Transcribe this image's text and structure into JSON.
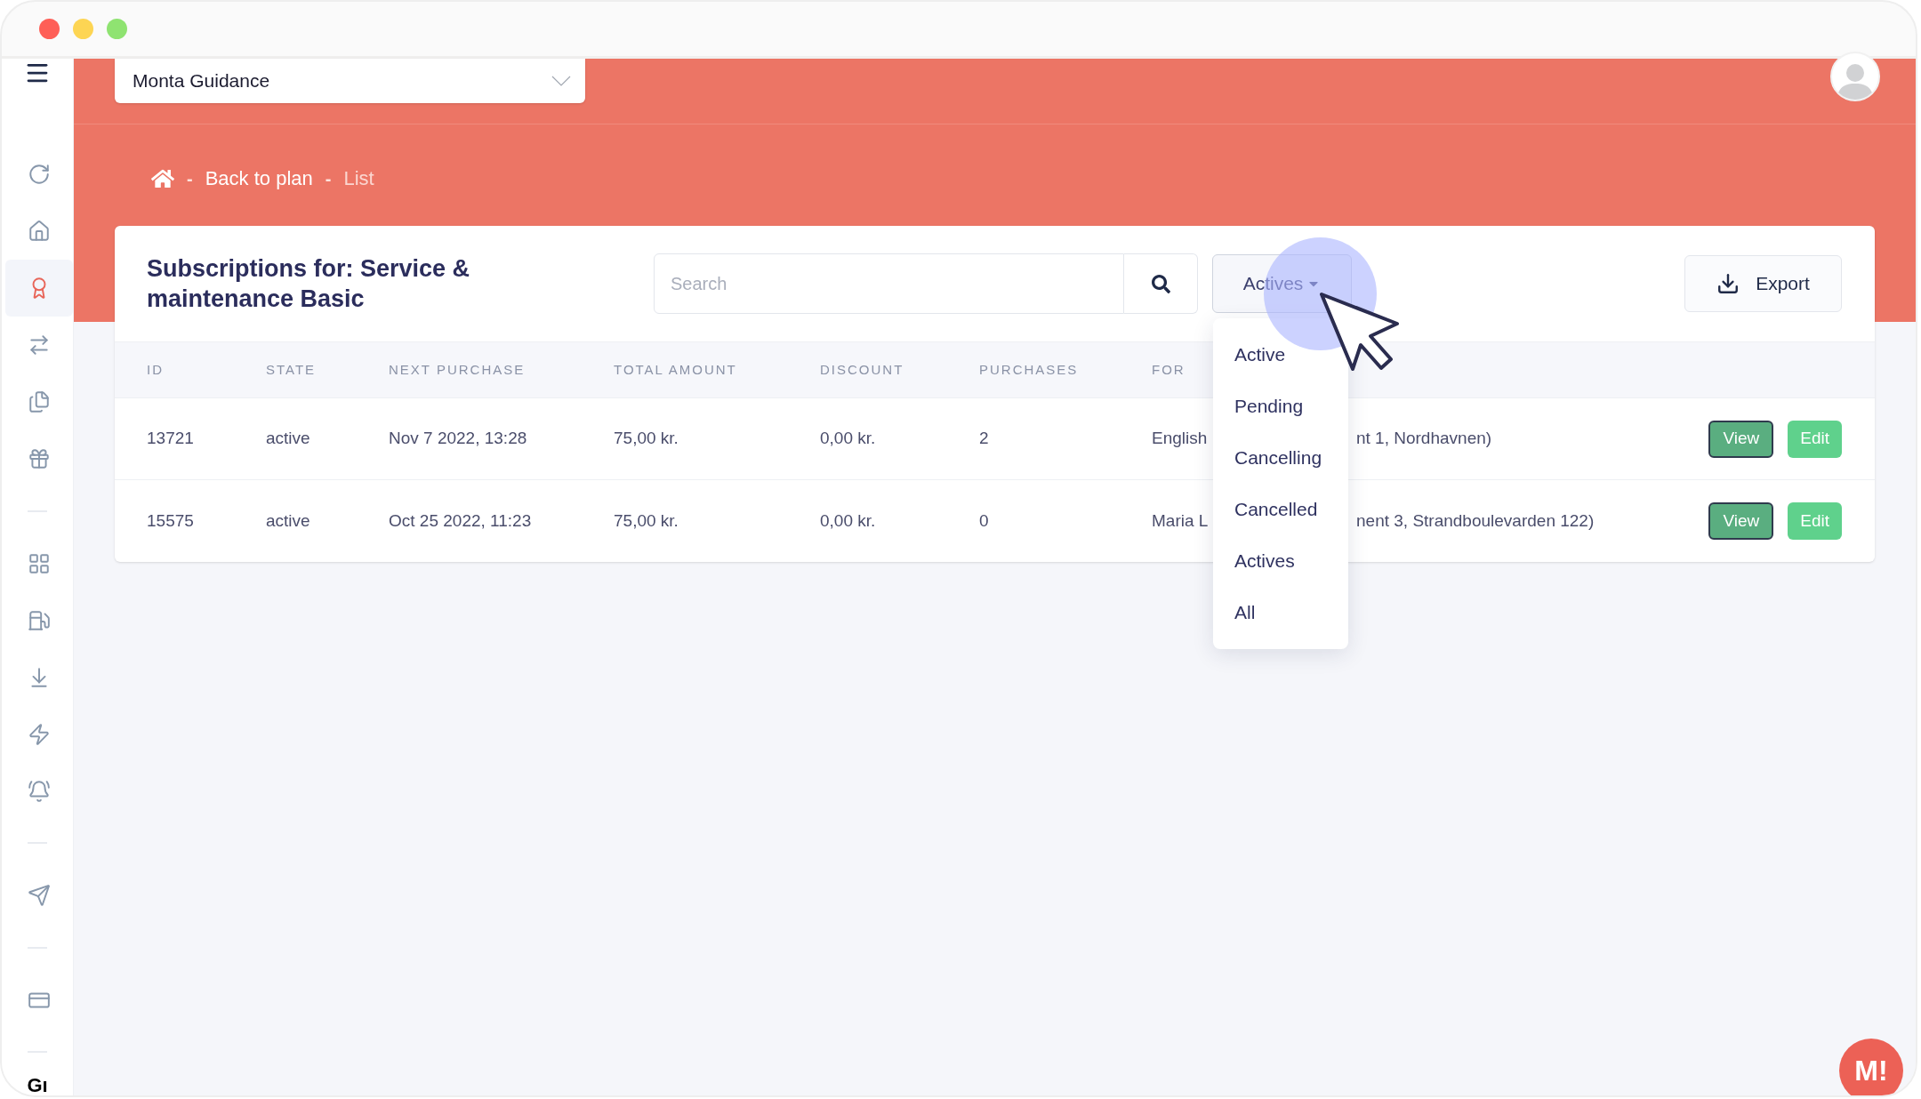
{
  "top_bar": {
    "workspace_select": {
      "value": "Monta Guidance"
    }
  },
  "sidebar": {
    "groups": [
      {
        "items": [
          {
            "kind": "refresh",
            "selected": false
          },
          {
            "kind": "home",
            "selected": false
          },
          {
            "kind": "award",
            "selected": true
          },
          {
            "kind": "transfer",
            "selected": false
          },
          {
            "kind": "documents",
            "selected": false
          },
          {
            "kind": "gift",
            "selected": false
          }
        ]
      },
      {
        "items": [
          {
            "kind": "grid",
            "selected": false
          },
          {
            "kind": "fuel",
            "selected": false
          },
          {
            "kind": "download",
            "selected": false
          },
          {
            "kind": "bolt",
            "selected": false
          },
          {
            "kind": "bell",
            "selected": false
          }
        ]
      },
      {
        "items": [
          {
            "kind": "send",
            "selected": false
          }
        ]
      },
      {
        "items": [
          {
            "kind": "cards",
            "selected": false
          }
        ]
      }
    ],
    "footer_text": "Gı"
  },
  "breadcrumb": [
    {
      "kind": "home"
    },
    {
      "kind": "separator",
      "label": "-"
    },
    {
      "kind": "link",
      "label": "Back to plan"
    },
    {
      "kind": "separator",
      "label": "-"
    },
    {
      "kind": "current",
      "label": "List"
    }
  ],
  "card": {
    "title": "Subscriptions for: Service & maintenance Basic",
    "search": {
      "placeholder": "Search"
    },
    "filter": {
      "label": "Actives",
      "expanded": true,
      "options": [
        "Active",
        "Pending",
        "Cancelling",
        "Cancelled",
        "Actives",
        "All"
      ]
    },
    "export_button": "Export",
    "table": {
      "columns": [
        "ID",
        "STATE",
        "NEXT PURCHASE",
        "TOTAL AMOUNT",
        "DISCOUNT",
        "PURCHASES",
        "FOR"
      ],
      "rows": [
        {
          "id": "13721",
          "state": "active",
          "next_purchase": "Nov 7 2022, 13:28",
          "total_amount": "75,00 kr.",
          "discount": "0,00 kr.",
          "purchases": "2",
          "for_start": "English",
          "for_end": "nt 1, Nordhavnen)",
          "actions": [
            "View",
            "Edit"
          ]
        },
        {
          "id": "15575",
          "state": "active",
          "next_purchase": "Oct 25 2022, 11:23",
          "total_amount": "75,00 kr.",
          "discount": "0,00 kr.",
          "purchases": "0",
          "for_start": "Maria L",
          "for_end": "nent 3, Strandboulevarden 122)",
          "actions": [
            "View",
            "Edit"
          ]
        }
      ]
    }
  },
  "chat_button": {
    "label": "M!"
  }
}
